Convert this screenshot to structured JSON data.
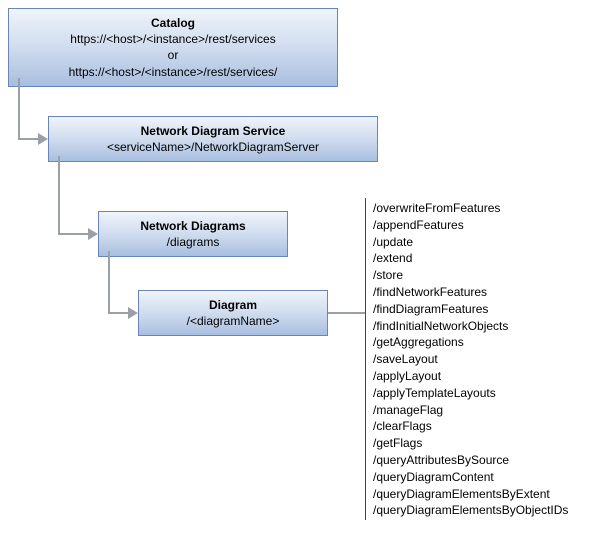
{
  "catalog": {
    "title": "Catalog",
    "url1": "https://<host>/<instance>/rest/services",
    "or": "or",
    "url2": "https://<host>/<instance>/rest/services/"
  },
  "service": {
    "title": "Network Diagram Service",
    "path": "<serviceName>/NetworkDiagramServer"
  },
  "diagrams": {
    "title": "Network Diagrams",
    "path": "/diagrams"
  },
  "diagram": {
    "title": "Diagram",
    "path": "/<diagramName>"
  },
  "endpoints": [
    "/overwriteFromFeatures",
    "/appendFeatures",
    "/update",
    "/extend",
    "/store",
    "/findNetworkFeatures",
    "/findDiagramFeatures",
    "/findInitialNetworkObjects",
    "/getAggregations",
    "/saveLayout",
    "/applyLayout",
    "/applyTemplateLayouts",
    "/manageFlag",
    "/clearFlags",
    "/getFlags",
    "/queryAttributesBySource",
    "/queryDiagramContent",
    "/queryDiagramElementsByExtent",
    "/queryDiagramElementsByObjectIDs"
  ]
}
